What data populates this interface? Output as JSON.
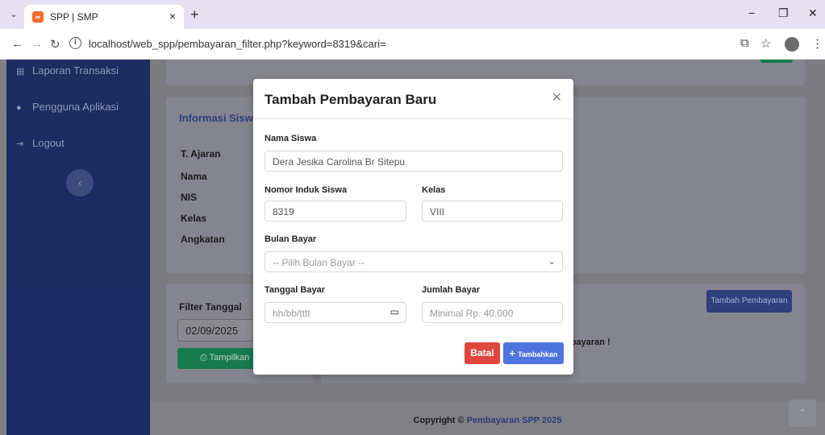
{
  "browser": {
    "tab_title": "SPP | SMP",
    "url": "localhost/web_spp/pembayaran_filter.php?keyword=8319&cari=",
    "favicon_label": "∞"
  },
  "sidebar": {
    "items": [
      {
        "label": "Laporan Transaksi",
        "icon": "file-icon"
      },
      {
        "label": "Pengguna Aplikasi",
        "icon": "user-icon"
      },
      {
        "label": "Logout",
        "icon": "logout-icon"
      }
    ]
  },
  "background": {
    "info_title": "Informasi Siswa",
    "info_labels": [
      "T. Ajaran",
      "Nama",
      "NIS",
      "Kelas",
      "Angkatan"
    ],
    "filter_label": "Filter Tanggal",
    "filter_date": "02/09/2025",
    "show_button": "Tampilkan",
    "add_payment_button": "Tambah Pembayaran",
    "notice_fragment": "mbayaran !",
    "footer_prefix": "Copyright © ",
    "footer_link": "Pembayaran SPP 2025"
  },
  "modal": {
    "title": "Tambah Pembayaran Baru",
    "name_label": "Nama Siswa",
    "name_value": "Dera Jesika Carolina Br Sitepu",
    "nis_label": "Nomor Induk Siswa",
    "nis_value": "8319",
    "class_label": "Kelas",
    "class_value": "VIII",
    "month_label": "Bulan Bayar",
    "month_placeholder": "-- Pilih Bulan Bayar --",
    "date_label": "Tanggal Bayar",
    "date_placeholder": "hh/bb/tttt",
    "amount_label": "Jumlah Bayar",
    "amount_placeholder": "Minimal Rp. 40,000",
    "cancel_label": "Batal",
    "submit_label": "Tambahkan"
  },
  "colors": {
    "primary": "#4e73df",
    "danger": "#e0453c",
    "success": "#1cc88a",
    "sidebar": "#224abe"
  }
}
